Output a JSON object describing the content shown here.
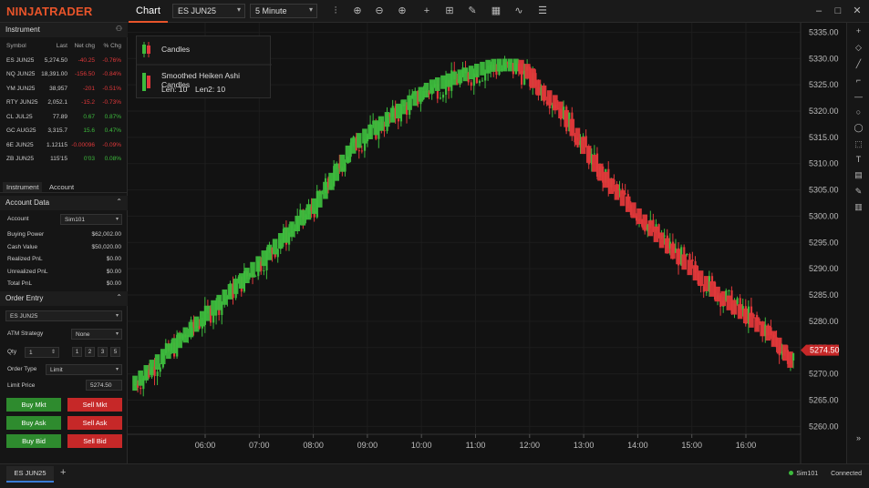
{
  "app": {
    "logo": "NINJATRADER",
    "tab": "Chart"
  },
  "toolbar": {
    "instrument": "ES JUN25",
    "interval": "5 Minute"
  },
  "watchlist": {
    "title": "Instrument",
    "headers": [
      "Symbol",
      "Last",
      "Net chg",
      "% Chg"
    ],
    "rows": [
      {
        "symbol": "ES JUN25",
        "last": "5,274.50",
        "chg": "-40.25",
        "pct": "-0.76%",
        "dir": "neg"
      },
      {
        "symbol": "NQ JUN25",
        "last": "18,391.00",
        "chg": "-156.50",
        "pct": "-0.84%",
        "dir": "neg"
      },
      {
        "symbol": "YM JUN25",
        "last": "38,957",
        "chg": "-201",
        "pct": "-0.51%",
        "dir": "neg"
      },
      {
        "symbol": "RTY JUN25",
        "last": "2,052.1",
        "chg": "-15.2",
        "pct": "-0.73%",
        "dir": "neg"
      },
      {
        "symbol": "CL JUL25",
        "last": "77.89",
        "chg": "0.67",
        "pct": "0.87%",
        "dir": "pos"
      },
      {
        "symbol": "GC AUG25",
        "last": "3,315.7",
        "chg": "15.6",
        "pct": "0.47%",
        "dir": "pos"
      },
      {
        "symbol": "6E JUN25",
        "last": "1.12115",
        "chg": "-0.00096",
        "pct": "-0.09%",
        "dir": "neg"
      },
      {
        "symbol": "ZB JUN25",
        "last": "115'15",
        "chg": "0'03",
        "pct": "0.08%",
        "dir": "pos"
      }
    ]
  },
  "tabs": [
    "Instrument",
    "Account"
  ],
  "account": {
    "title": "Account Data",
    "account_label": "Account",
    "account_value": "Sim101",
    "rows": [
      {
        "k": "Buying Power",
        "v": "$62,002.00"
      },
      {
        "k": "Cash Value",
        "v": "$50,020.00"
      },
      {
        "k": "Realized PnL",
        "v": "$0.00"
      },
      {
        "k": "Unrealized PnL",
        "v": "$0.00"
      },
      {
        "k": "Total PnL",
        "v": "$0.00"
      }
    ]
  },
  "order": {
    "title": "Order Entry",
    "instrument": "ES JUN25",
    "atm_label": "ATM Strategy",
    "atm_value": "None",
    "qty_label": "Qty",
    "qty_value": "1",
    "qty_presets": [
      "1",
      "2",
      "3",
      "5"
    ],
    "type_label": "Order Type",
    "type_value": "Limit",
    "limit_label": "Limit Price",
    "limit_value": "5274.50",
    "buttons": [
      "Buy Mkt",
      "Sell Mkt",
      "Buy Ask",
      "Sell Ask",
      "Buy Bid",
      "Sell Bid"
    ]
  },
  "legend": {
    "item1": "Candles",
    "item2": "Smoothed Heiken Ashi Candles",
    "params1": "Len: 10",
    "params2": "Len2: 10"
  },
  "chart_data": {
    "type": "candlestick",
    "x_ticks": [
      "06:00",
      "07:00",
      "08:00",
      "09:00",
      "10:00",
      "11:00",
      "12:00",
      "13:00",
      "14:00",
      "15:00",
      "16:00"
    ],
    "y_ticks": [
      5335,
      5330,
      5325,
      5320,
      5315,
      5310,
      5305,
      5300,
      5295,
      5290,
      5285,
      5280,
      5275,
      5270,
      5265,
      5260
    ],
    "ylim": [
      5258.5,
      5336.8
    ],
    "last_price": "5274.50",
    "up_color": "#3dbb3d",
    "down_color": "#e0383a",
    "path": [
      [
        0,
        5268
      ],
      [
        52,
        5288
      ],
      [
        86,
        5302
      ],
      [
        103,
        5313
      ],
      [
        140,
        5324
      ],
      [
        169,
        5328
      ],
      [
        182,
        5328
      ],
      [
        200,
        5322
      ],
      [
        222,
        5308
      ],
      [
        250,
        5296
      ],
      [
        276,
        5286
      ],
      [
        302,
        5278
      ],
      [
        314,
        5272
      ]
    ]
  },
  "bottom": {
    "tab": "ES JUN25",
    "add": "+",
    "account": "Sim101",
    "status": "Connected"
  },
  "icons": {
    "menu": [
      "plus",
      "diamond",
      "line",
      "ray",
      "horizontal-line",
      "circle",
      "circle-outline",
      "rect",
      "text",
      "note",
      "pencil",
      "trash",
      "double-chevron"
    ]
  }
}
